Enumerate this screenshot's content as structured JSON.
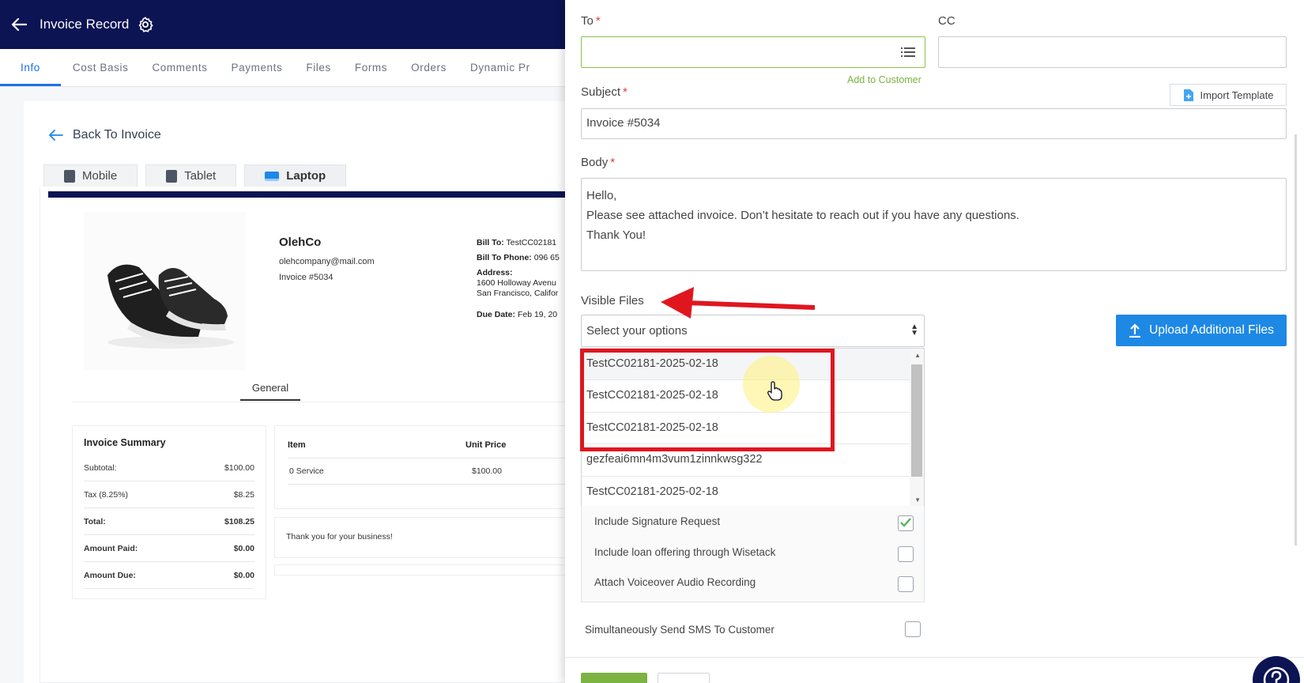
{
  "header": {
    "title": "Invoice Record"
  },
  "tabs": [
    "Info",
    "Cost Basis",
    "Comments",
    "Payments",
    "Files",
    "Forms",
    "Orders",
    "Dynamic Pr"
  ],
  "back_link": "Back To Invoice",
  "devices": [
    "Mobile",
    "Tablet",
    "Laptop"
  ],
  "invoice": {
    "company": "OlehCo",
    "email": "olehcompany@mail.com",
    "number": "Invoice #5034",
    "bill_to_label": "Bill To:",
    "bill_to": "TestCC02181",
    "bill_phone_label": "Bill To Phone:",
    "bill_phone": "096 65",
    "address_label": "Address:",
    "address_1": "1600 Holloway Avenu",
    "address_2": "San Francisco, Califor",
    "due_label": "Due Date:",
    "due": "Feb 19, 20",
    "tab_general": "General",
    "summary_title": "Invoice Summary",
    "summary": [
      {
        "label": "Subtotal:",
        "value": "$100.00"
      },
      {
        "label": "Tax (8.25%)",
        "value": "$8.25"
      },
      {
        "label": "Total:",
        "value": "$108.25"
      },
      {
        "label": "Amount Paid:",
        "value": "$0.00"
      },
      {
        "label": "Amount Due:",
        "value": "$0.00"
      }
    ],
    "items_header": {
      "item": "Item",
      "unit_price": "Unit Price"
    },
    "items": [
      {
        "item": "0 Service",
        "unit_price": "$100.00"
      }
    ],
    "thanks": "Thank you for your business!"
  },
  "email_form": {
    "to_label": "To",
    "cc_label": "CC",
    "add_customer": "Add to Customer",
    "subject_label": "Subject",
    "import_template": "Import Template",
    "subject_value": "Invoice #5034",
    "body_label": "Body",
    "body_lines": [
      "Hello,",
      "Please see attached invoice. Don’t hesitate to reach out if you have any questions.",
      "Thank You!"
    ],
    "visible_files_label": "Visible Files",
    "select_placeholder": "Select your options",
    "file_options": [
      "TestCC02181-2025-02-18",
      "TestCC02181-2025-02-18",
      "TestCC02181-2025-02-18",
      "gezfeai6mn4m3vum1zinnkwsg322",
      "TestCC02181-2025-02-18"
    ],
    "upload_button": "Upload Additional Files",
    "checkboxes": [
      {
        "label": "Include Signature Request",
        "checked": true
      },
      {
        "label": "Include loan offering through Wisetack",
        "checked": false
      },
      {
        "label": "Attach Voiceover Audio Recording",
        "checked": false
      }
    ],
    "sms_label": "Simultaneously Send SMS To Customer"
  },
  "colors": {
    "navy": "#0c1453",
    "accent_blue": "#1e88e5",
    "green": "#7cb342",
    "annotation_red": "#e0161f"
  }
}
